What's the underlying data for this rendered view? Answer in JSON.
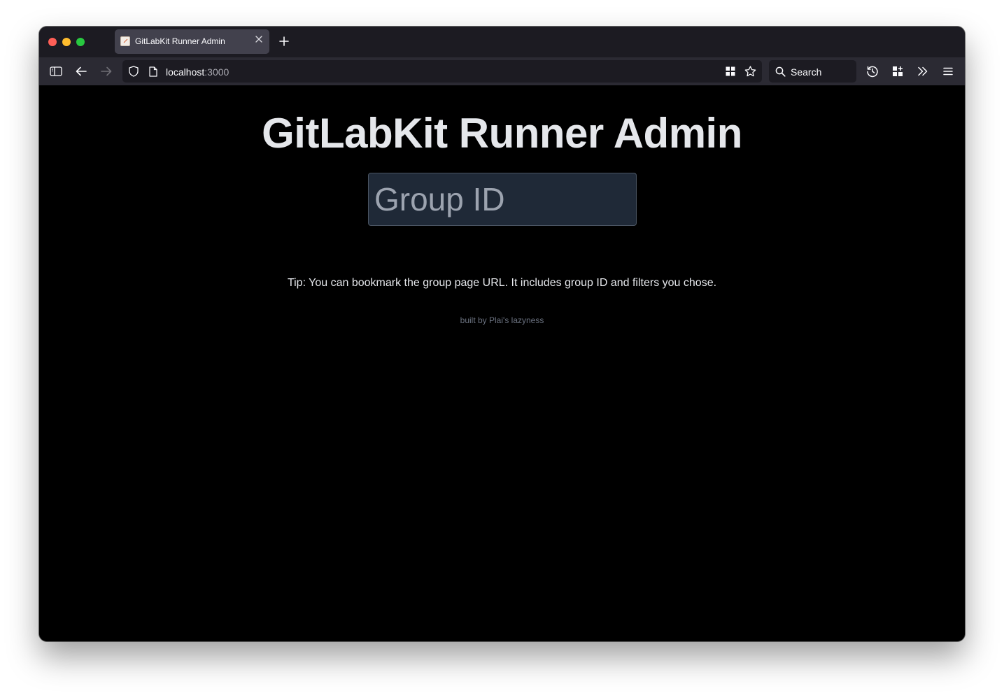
{
  "browser": {
    "tab": {
      "title": "GitLabKit Runner Admin",
      "close_icon": "close-icon",
      "favicon": "app-favicon"
    },
    "new_tab_icon": "plus-icon",
    "url": {
      "host": "localhost",
      "port": ":3000"
    },
    "search": {
      "label": "Search"
    },
    "toolbar_icons": [
      "sidebar-icon",
      "back-arrow-icon",
      "forward-arrow-icon",
      "shield-icon",
      "page-icon",
      "grid-icon",
      "star-icon",
      "search-icon",
      "history-icon",
      "extensions-icon",
      "chevron-double-right-icon",
      "hamburger-menu-icon"
    ]
  },
  "page": {
    "title": "GitLabKit Runner Admin",
    "group_input": {
      "placeholder": "Group ID",
      "value": ""
    },
    "tip": "Tip: You can bookmark the group page URL. It includes group ID and filters you chose.",
    "footer": "built by Plai's lazyness"
  },
  "colors": {
    "page_background": "#000000",
    "title_text": "#e5e7eb",
    "input_background": "#1f2937",
    "input_border": "#4b5563",
    "footer_text": "#6b7280",
    "chrome_tabbar": "#1c1b22",
    "chrome_navbar": "#2b2a33"
  }
}
